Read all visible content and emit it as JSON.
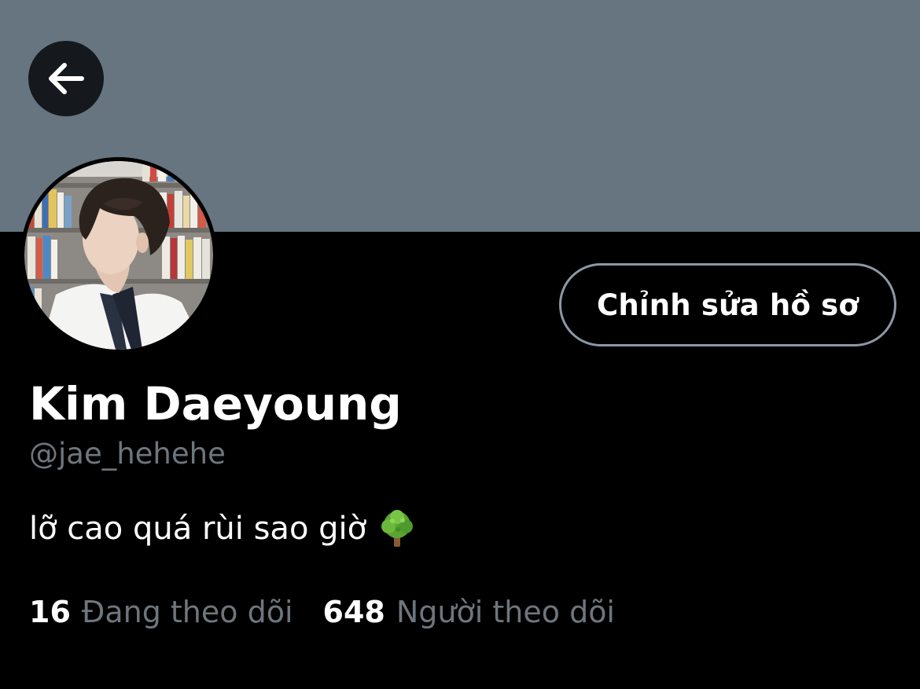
{
  "profile": {
    "banner_color": "#66757f",
    "back_icon": "arrow-left-icon",
    "avatar_icon": "profile-photo",
    "edit_button_label": "Chỉnh sửa hồ sơ",
    "display_name": "Kim Daeyoung",
    "handle": "@jae_hehehe",
    "bio": "lỡ cao quá rùi sao giờ",
    "bio_emoji_icon": "deciduous-tree-icon",
    "following_count": "16",
    "following_label": "Đang theo dõi",
    "followers_count": "648",
    "followers_label": "Người theo dõi"
  }
}
